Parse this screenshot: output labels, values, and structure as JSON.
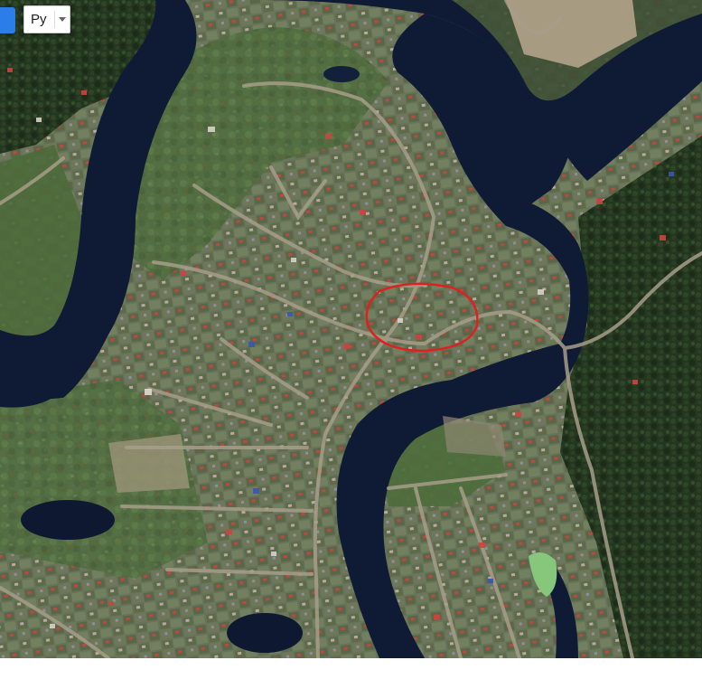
{
  "controls": {
    "language_selector": {
      "label": "Ру",
      "icon": "chevron-down-icon"
    }
  },
  "map": {
    "type": "satellite",
    "highlight": {
      "shape": "ellipse",
      "color": "#e02020"
    }
  },
  "colors": {
    "water": "#0f1a35",
    "vegetation": "#3a4f2a",
    "marsh": "#4e6a3c",
    "settlement": "#6b7360",
    "roads": "#a49a86",
    "accent_blue": "#2b7de9"
  }
}
